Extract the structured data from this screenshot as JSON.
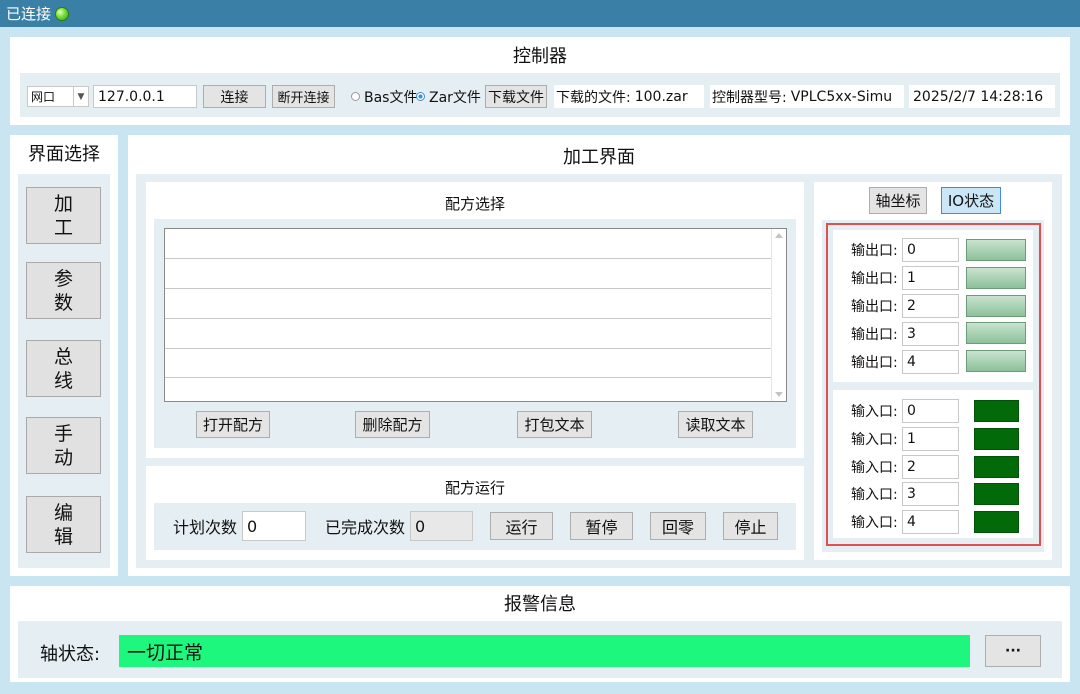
{
  "titlebar": {
    "status": "已连接",
    "led_color": "#5fd12a"
  },
  "controller": {
    "title": "控制器",
    "port_type": "网口",
    "ip": "127.0.0.1",
    "connect_label": "连接",
    "disconnect_label": "断开连接",
    "radio_bas_label": "Bas文件",
    "radio_zar_label": "Zar文件",
    "download_label": "下载文件",
    "downloaded_file_label": "下载的文件:",
    "downloaded_file_value": "100.zar",
    "model_label": "控制器型号:",
    "model_value": "VPLC5xx-Simu",
    "datetime": "2025/2/7 14:28:16"
  },
  "sidebar": {
    "title": "界面选择",
    "items": [
      {
        "l1": "加",
        "l2": "工"
      },
      {
        "l1": "参",
        "l2": "数"
      },
      {
        "l1": "总",
        "l2": "线"
      },
      {
        "l1": "手",
        "l2": "动"
      },
      {
        "l1": "编",
        "l2": "辑"
      }
    ]
  },
  "main": {
    "title": "加工界面",
    "recipe_select": {
      "title": "配方选择",
      "buttons": [
        "打开配方",
        "删除配方",
        "打包文本",
        "读取文本"
      ]
    },
    "recipe_run": {
      "title": "配方运行",
      "planned_label": "计划次数",
      "planned_value": "0",
      "completed_label": "已完成次数",
      "completed_value": "0",
      "buttons": [
        "运行",
        "暂停",
        "回零",
        "停止"
      ]
    },
    "tabs": [
      "轴坐标",
      "IO状态"
    ],
    "active_tab": "IO状态",
    "outputs": [
      {
        "label": "输出口:",
        "value": "0"
      },
      {
        "label": "输出口:",
        "value": "1"
      },
      {
        "label": "输出口:",
        "value": "2"
      },
      {
        "label": "输出口:",
        "value": "3"
      },
      {
        "label": "输出口:",
        "value": "4"
      }
    ],
    "inputs": [
      {
        "label": "输入口:",
        "value": "0"
      },
      {
        "label": "输入口:",
        "value": "1"
      },
      {
        "label": "输入口:",
        "value": "2"
      },
      {
        "label": "输入口:",
        "value": "3"
      },
      {
        "label": "输入口:",
        "value": "4"
      }
    ],
    "highlight_color": "#e05050"
  },
  "alarm": {
    "title": "报警信息",
    "axis_label": "轴状态:",
    "axis_value": "一切正常",
    "status_color": "#1ef77e",
    "more_label": "···"
  }
}
